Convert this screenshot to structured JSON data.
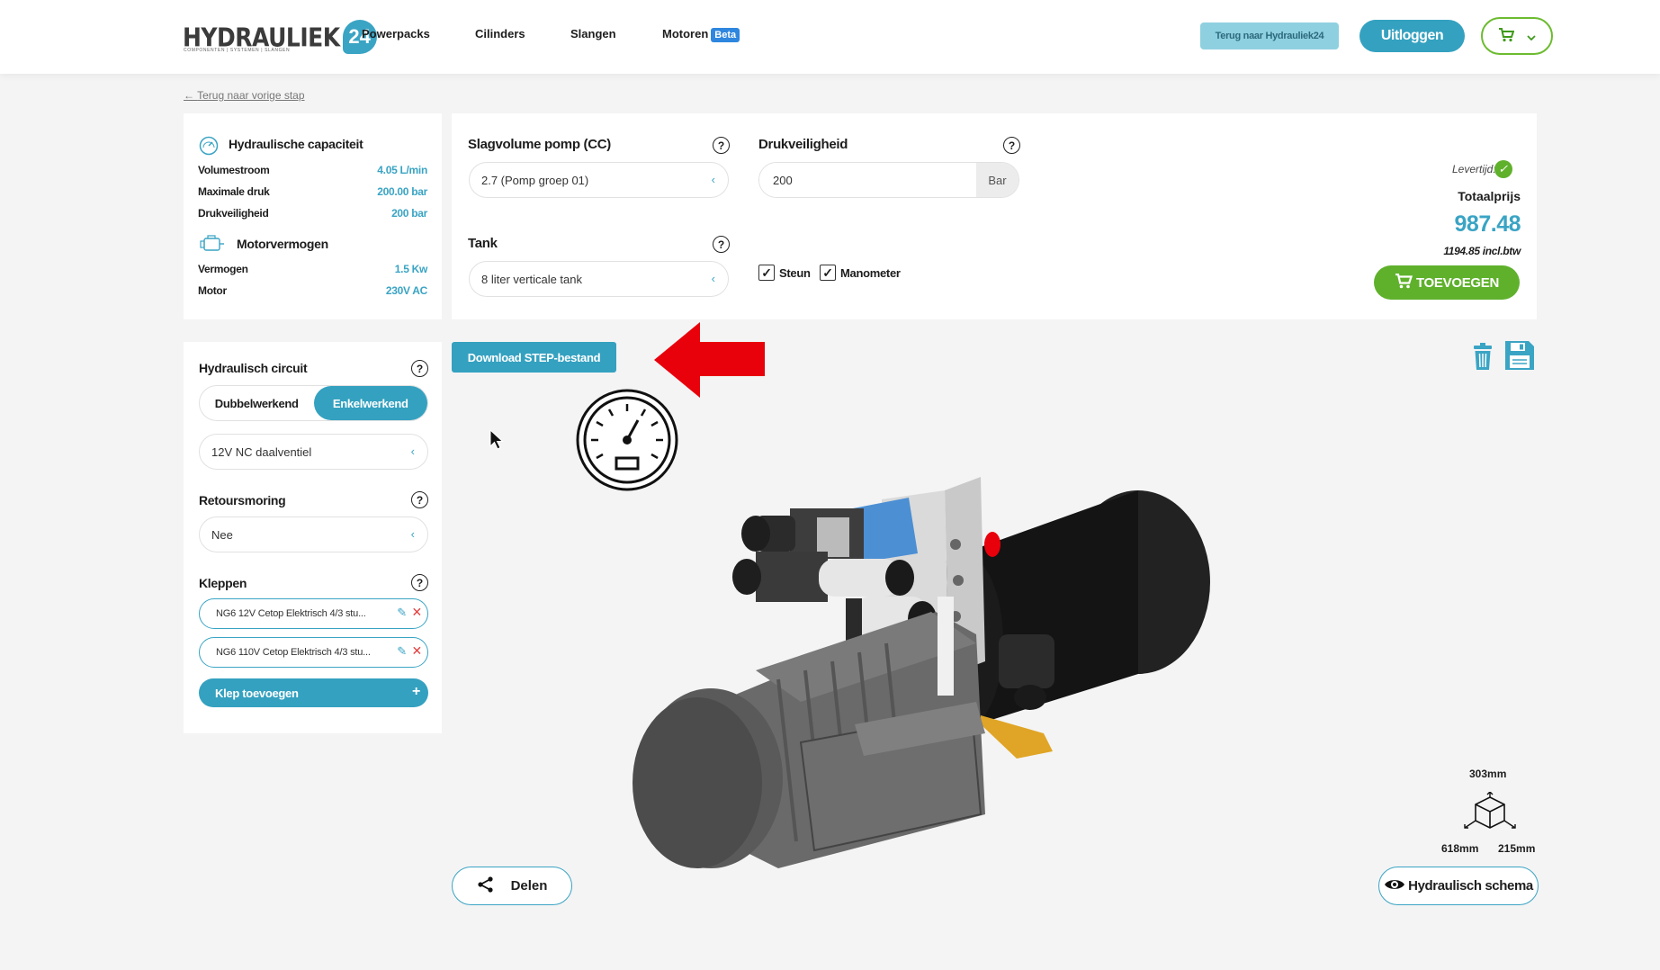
{
  "header": {
    "logo": "HYDRAULIEK",
    "logo_number": "24",
    "logo_sub": "COMPONENTEN | SYSTEMEN | SLANGEN",
    "nav": [
      {
        "label": "Powerpacks"
      },
      {
        "label": "Cilinders"
      },
      {
        "label": "Slangen"
      },
      {
        "label": "Motoren",
        "badge": "Beta"
      }
    ],
    "back_button": "Terug naar Hydrauliek24",
    "logout_button": "Uitloggen",
    "cart_icon": "cart-icon"
  },
  "back_link": "Terug naar vorige stap",
  "capacity": {
    "title": "Hydraulische capaciteit",
    "rows": [
      {
        "label": "Volumestroom",
        "value": "4.05 L/min"
      },
      {
        "label": "Maximale druk",
        "value": "200.00 bar"
      },
      {
        "label": "Drukveiligheid",
        "value": "200 bar"
      }
    ],
    "motor_title": "Motorvermogen",
    "motor_rows": [
      {
        "label": "Vermogen",
        "value": "1.5 Kw"
      },
      {
        "label": "Motor",
        "value": "230V AC"
      }
    ]
  },
  "config": {
    "pump_label": "Slagvolume pomp (CC)",
    "pump_value": "2.7 (Pomp groep 01)",
    "pressure_label": "Drukveiligheid",
    "pressure_value": "200",
    "pressure_unit": "Bar",
    "tank_label": "Tank",
    "tank_value": "8 liter verticale tank",
    "check_steun": "Steun",
    "check_manometer": "Manometer",
    "levertijd": "Levertijd:",
    "total_label": "Totaalprijs",
    "total_price": "987.48",
    "total_incl": "1194.85 incl.btw",
    "add_button": "TOEVOEGEN"
  },
  "circuit": {
    "title": "Hydraulisch circuit",
    "options": [
      "Dubbelwerkend",
      "Enkelwerkend"
    ],
    "active_option": "Enkelwerkend",
    "valve_select": "12V NC daalventiel",
    "return_title": "Retoursmoring",
    "return_value": "Nee",
    "valves_title": "Kleppen",
    "valves": [
      "NG6 12V Cetop Elektrisch 4/3 stu...",
      "NG6 110V Cetop Elektrisch 4/3 stu..."
    ],
    "add_valve_button": "Klep toevoegen"
  },
  "viewer": {
    "download_button": "Download STEP-bestand",
    "share_button": "Delen",
    "schema_button": "Hydraulisch schema",
    "dim_height": "303mm",
    "dim_length": "618mm",
    "dim_width": "215mm"
  },
  "colors": {
    "accent": "#34a1c0",
    "green": "#5fb12c",
    "arrow": "#e8000b"
  }
}
